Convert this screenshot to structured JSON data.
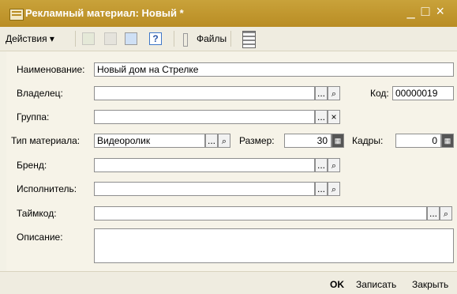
{
  "window": {
    "title": "Рекламный материал: Новый *",
    "controls": [
      "_",
      "□",
      "×"
    ]
  },
  "toolbar": {
    "actions_label": "Действия ▾",
    "files_label": "Файлы",
    "help_label": "?"
  },
  "form": {
    "name_label": "Наименование:",
    "name_value": "Новый дом на Стрелке",
    "owner_label": "Владелец:",
    "owner_value": "",
    "code_label": "Код:",
    "code_value": "00000019",
    "group_label": "Группа:",
    "group_value": "",
    "material_type_label": "Тип материала:",
    "material_type_value": "Видеоролик",
    "size_label": "Размер:",
    "size_value": "30",
    "frames_label": "Кадры:",
    "frames_value": "0",
    "brand_label": "Бренд:",
    "brand_value": "",
    "performer_label": "Исполнитель:",
    "performer_value": "",
    "timecode_label": "Таймкод:",
    "timecode_value": "",
    "description_label": "Описание:",
    "description_value": "",
    "ellipsis": "...",
    "clear_symbol": "×"
  },
  "footer": {
    "ok_label": "OK",
    "save_label": "Записать",
    "close_label": "Закрыть"
  }
}
